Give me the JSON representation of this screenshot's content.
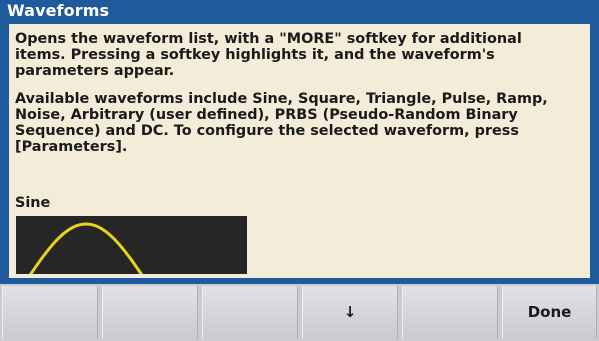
{
  "title": "Waveforms",
  "help": {
    "paragraph1": "Opens the waveform list, with a \"MORE\" softkey for additional\nitems. Pressing a softkey highlights it, and the waveform's\nparameters appear.",
    "paragraph2": "Available waveforms include Sine, Square, Triangle, Pulse, Ramp,\nNoise, Arbitrary (user defined), PRBS (Pseudo-Random Binary\nSequence) and DC. To configure the selected waveform, press\n[Parameters]."
  },
  "preview": {
    "label": "Sine",
    "trace_color": "#e8d21c",
    "background_color": "#262626"
  },
  "softkeys": [
    {
      "label": ""
    },
    {
      "label": ""
    },
    {
      "label": ""
    },
    {
      "label": "↓",
      "icon": "arrow-down-icon"
    },
    {
      "label": ""
    },
    {
      "label": "Done"
    }
  ],
  "colors": {
    "title_bar": "#1f5a9c",
    "content_background": "#f3ecd8",
    "softkey_background": "#d4d4d9"
  }
}
